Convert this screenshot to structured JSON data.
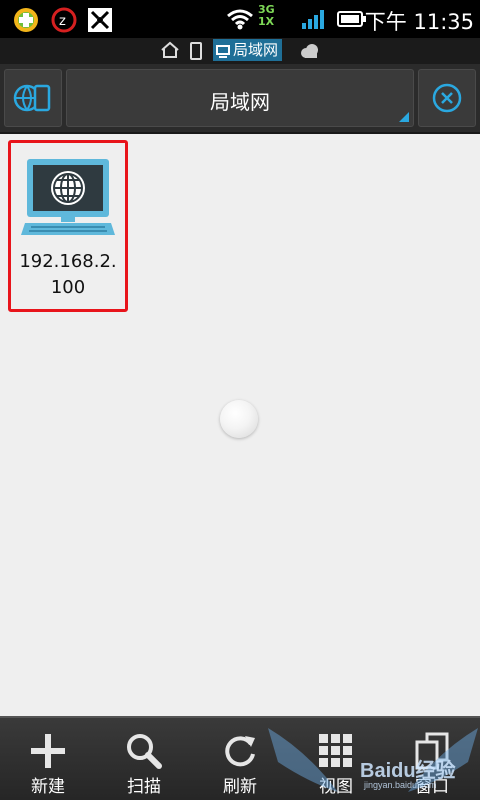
{
  "status_bar": {
    "network_top": "3G",
    "network_bottom": "1X",
    "time": "下午 11:35",
    "icons": [
      "app-icon",
      "zapya-icon",
      "cat-icon",
      "wifi-icon",
      "signal-icon",
      "battery-icon"
    ]
  },
  "breadcrumb": {
    "items": [
      "home-icon",
      "phone-icon"
    ],
    "current": "局域网",
    "trailing": "cloud-icon"
  },
  "toolbar": {
    "location_title": "局域网",
    "left_button_icon": "network-device-icon",
    "right_button_icon": "close-circle-icon",
    "accent": "#2aa8e0"
  },
  "files": [
    {
      "name": "192.168.2.100",
      "label_line1": "192.168.2.",
      "label_line2": "100",
      "icon": "lan-computer-icon",
      "selected": true,
      "highlight_color": "#e8141b"
    }
  ],
  "bottom_bar": {
    "items": [
      {
        "label": "新建",
        "icon": "plus-icon"
      },
      {
        "label": "扫描",
        "icon": "search-icon"
      },
      {
        "label": "刷新",
        "icon": "refresh-icon"
      },
      {
        "label": "视图",
        "icon": "grid-icon"
      },
      {
        "label": "窗口",
        "icon": "windows-icon"
      }
    ]
  },
  "watermark": {
    "text": "Baidu经验",
    "sub": "jingyan.baidu.com"
  }
}
